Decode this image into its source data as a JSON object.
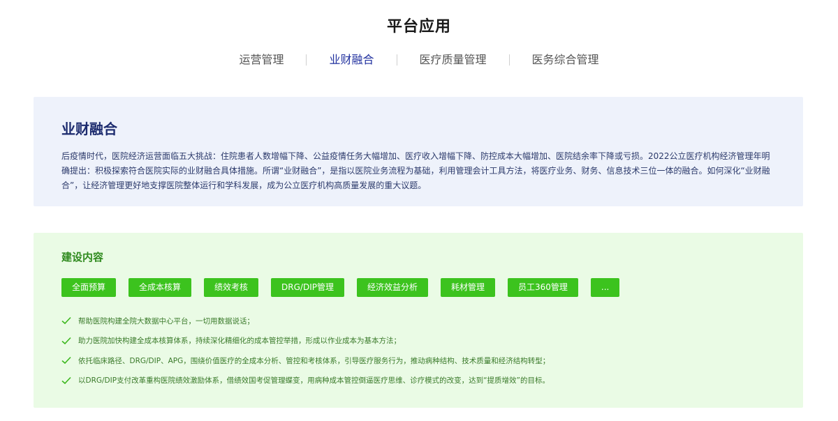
{
  "page": {
    "title": "平台应用"
  },
  "tabs": [
    {
      "label": "运营管理"
    },
    {
      "label": "业财融合"
    },
    {
      "label": "医疗质量管理"
    },
    {
      "label": "医务综合管理"
    }
  ],
  "intro": {
    "title": "业财融合",
    "text": "后疫情时代，医院经济运营面临五大挑战：住院患者人数增幅下降、公益疫情任务大幅增加、医疗收入增幅下降、防控成本大幅增加、医院结余率下降或亏损。2022公立医疗机构经济管理年明确提出：积极探索符合医院实际的业财融合具体措施。所谓“业财融合”，是指以医院业务流程为基础，利用管理会计工具方法，将医疗业务、财务、信息技术三位一体的融合。如何深化“业财融合”，让经济管理更好地支撑医院整体运行和学科发展，成为公立医疗机构高质量发展的重大议题。"
  },
  "build": {
    "title": "建设内容",
    "tags": [
      {
        "label": "全面预算"
      },
      {
        "label": "全成本核算"
      },
      {
        "label": "绩效考核"
      },
      {
        "label": "DRG/DIP管理"
      },
      {
        "label": "经济效益分析"
      },
      {
        "label": "耗材管理"
      },
      {
        "label": "员工360管理"
      },
      {
        "label": "..."
      }
    ],
    "points": [
      {
        "text": "帮助医院构建全院大数据中心平台，一切用数据说话；"
      },
      {
        "text": "助力医院加快构建全成本核算体系，持续深化精细化的成本管控举措，形成以作业成本为基本方法；"
      },
      {
        "text": "依托临床路径、DRG/DIP、APG，围绕价值医疗的全成本分析、管控和考核体系，引导医疗服务行为，推动病种结构、技术质量和经济结构转型；"
      },
      {
        "text": "以DRG/DIP支付改革重构医院绩效激励体系，借绩效国考促管理蝶变，用病种成本管控倒逼医疗思维、诊疗模式的改变，达到“提质增效”的目标。"
      }
    ]
  },
  "colors": {
    "active_tab": "#1f2f9e",
    "tag_bg": "#3cc31e",
    "check": "#3cb71e",
    "intro_bg": "#eef2fb",
    "build_bg": "#eafbe5"
  }
}
